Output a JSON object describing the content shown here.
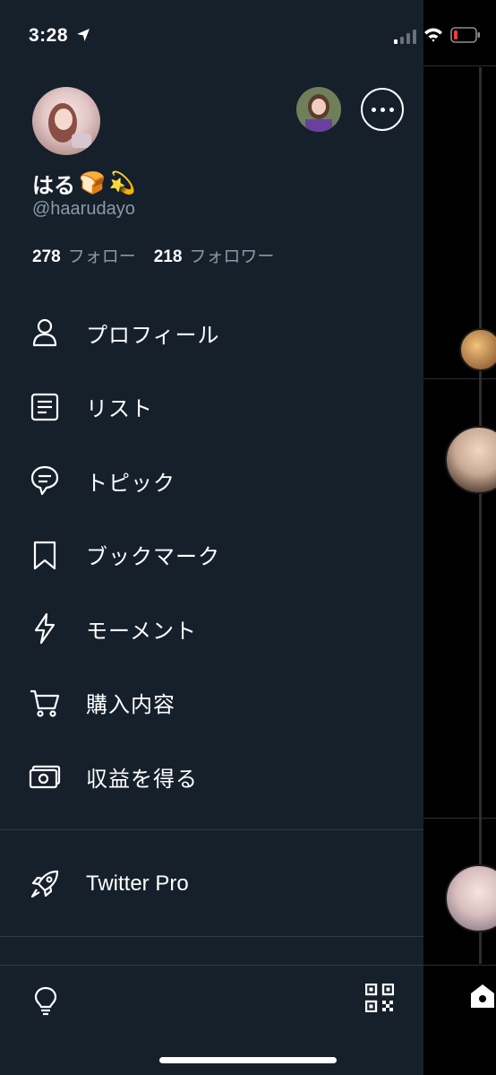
{
  "status_bar": {
    "time": "3:28"
  },
  "profile": {
    "display_name": "はる",
    "name_emojis": [
      "🍞",
      "💫"
    ],
    "handle": "@haarudayo",
    "following_count": "278",
    "following_label": "フォロー",
    "followers_count": "218",
    "followers_label": "フォロワー"
  },
  "menu": {
    "items": [
      {
        "label": "プロフィール",
        "icon": "person-icon"
      },
      {
        "label": "リスト",
        "icon": "list-icon"
      },
      {
        "label": "トピック",
        "icon": "topic-icon"
      },
      {
        "label": "ブックマーク",
        "icon": "bookmark-icon"
      },
      {
        "label": "モーメント",
        "icon": "lightning-icon"
      },
      {
        "label": "購入内容",
        "icon": "cart-icon"
      },
      {
        "label": "収益を得る",
        "icon": "money-icon"
      }
    ],
    "pro_label": "Twitter Pro"
  },
  "colors": {
    "drawer_bg": "#15202b",
    "text_primary": "#ffffff",
    "text_secondary": "#8b98a5",
    "divider": "#2f3a45",
    "battery_low": "#ff3b30"
  }
}
